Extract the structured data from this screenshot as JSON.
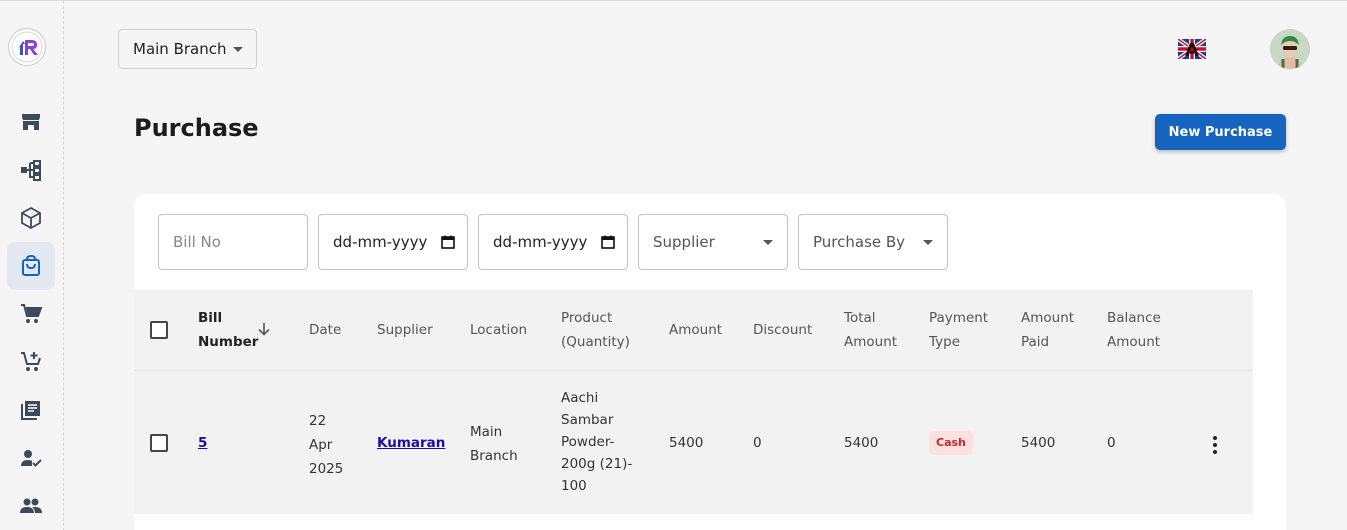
{
  "header": {
    "branch_selected": "Main Branch"
  },
  "sidebar": {
    "items": [
      {
        "icon": "store-icon"
      },
      {
        "icon": "hierarchy-icon"
      },
      {
        "icon": "box-icon"
      },
      {
        "icon": "shopping-bag-icon",
        "active": true
      },
      {
        "icon": "cart-icon"
      },
      {
        "icon": "add-cart-icon"
      },
      {
        "icon": "receipt-icon"
      },
      {
        "icon": "user-check-icon"
      },
      {
        "icon": "group-icon"
      }
    ]
  },
  "page": {
    "title": "Purchase",
    "new_button": "New Purchase"
  },
  "filters": {
    "bill_no_placeholder": "Bill No",
    "from_date": "dd-mm-yyyy",
    "to_date": "dd-mm-yyyy",
    "supplier_placeholder": "Supplier",
    "purchase_by_placeholder": "Purchase By"
  },
  "table": {
    "headers": {
      "bill_number_1": "Bill",
      "bill_number_2": "Number",
      "date": "Date",
      "supplier": "Supplier",
      "location": "Location",
      "product_1": "Product",
      "product_2": "(Quantity)",
      "amount": "Amount",
      "discount": "Discount",
      "total_1": "Total",
      "total_2": "Amount",
      "payment_1": "Payment",
      "payment_2": "Type",
      "paid_1": "Amount",
      "paid_2": "Paid",
      "balance_1": "Balance",
      "balance_2": "Amount"
    },
    "rows": [
      {
        "bill_number": "5",
        "date_1": "22",
        "date_2": "Apr",
        "date_3": "2025",
        "supplier": "Kumaran",
        "location_1": "Main",
        "location_2": "Branch",
        "product_1": "Aachi",
        "product_2": "Sambar",
        "product_3": "Powder-",
        "product_4": "200g (21)-",
        "product_5": "100",
        "amount": "5400",
        "discount": "0",
        "total": "5400",
        "payment_type": "Cash",
        "paid": "5400",
        "balance": "0"
      }
    ]
  },
  "colors": {
    "primary": "#1565c0",
    "badge_bg": "#fde0e0",
    "badge_text": "#c62828"
  }
}
